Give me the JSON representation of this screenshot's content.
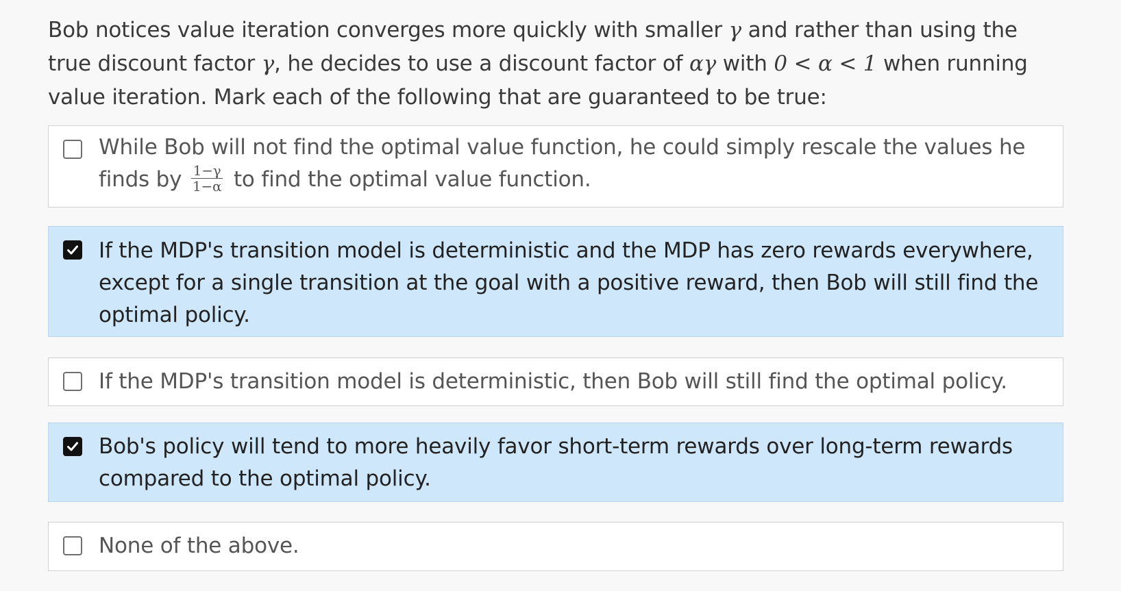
{
  "question": {
    "part1": "Bob notices value iteration converges more quickly with smaller ",
    "gamma1": "γ",
    "part2": " and rather than using the true discount factor ",
    "gamma2": "γ",
    "part3": ", he decides to use a discount factor of ",
    "alphagamma": "αγ",
    "part4": " with ",
    "ineq": "0 < α < 1",
    "part5": " when running value iteration.  Mark each of the following that are guaranteed to be true:"
  },
  "options": [
    {
      "checked": false,
      "text_before": "While Bob will not find the optimal value function, he could simply rescale the values he finds by ",
      "frac_num": "1−γ",
      "frac_den": "1−α",
      "text_after": " to find the optimal value function."
    },
    {
      "checked": true,
      "text": "If the MDP's transition model is deterministic and the MDP has zero rewards everywhere, except for a single transition at the goal with a positive reward, then Bob will still find the optimal policy."
    },
    {
      "checked": false,
      "text": "If the MDP's transition model is deterministic, then Bob will still find the optimal policy."
    },
    {
      "checked": true,
      "text": "Bob's policy will tend to more heavily favor short-term rewards over long-term rewards compared to the optimal policy."
    },
    {
      "checked": false,
      "text": "None of the above."
    }
  ],
  "colors": {
    "checked_bg": "#cfe7fb",
    "unchecked_bg": "#ffffff",
    "page_bg": "#f8f8f8"
  },
  "icons": {
    "checked": "checkmark-icon"
  }
}
